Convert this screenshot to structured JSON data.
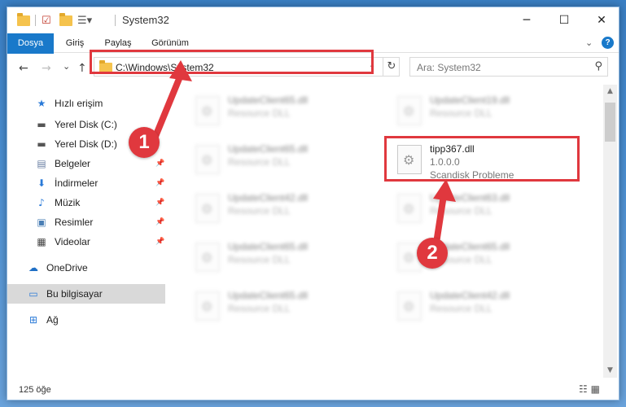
{
  "window": {
    "title": "System32",
    "controls": {
      "minimize": "─",
      "maximize": "☐",
      "close": "✕"
    }
  },
  "ribbon": {
    "tabs": [
      {
        "label": "Dosya",
        "active": true
      },
      {
        "label": "Giriş"
      },
      {
        "label": "Paylaş"
      },
      {
        "label": "Görünüm"
      }
    ],
    "help_label": "?"
  },
  "nav": {
    "back": "←",
    "forward": "→",
    "recent": "⌄",
    "up": "↑",
    "address": "C:\\Windows\\System32",
    "search_placeholder": "Ara: System32"
  },
  "sidebar": {
    "items": [
      {
        "label": "Hızlı erişim",
        "icon": "star-icon",
        "glyph": "★",
        "color": "#2a7ad8"
      },
      {
        "label": "Yerel Disk (C:)",
        "icon": "drive-icon",
        "glyph": "▬",
        "color": "#555555"
      },
      {
        "label": "Yerel Disk (D:)",
        "icon": "drive-icon",
        "glyph": "▬",
        "color": "#555555"
      },
      {
        "label": "Belgeler",
        "icon": "documents-icon",
        "glyph": "▤",
        "color": "#6a7fa3",
        "pinned": true
      },
      {
        "label": "İndirmeler",
        "icon": "download-icon",
        "glyph": "⬇",
        "color": "#2a7ad8",
        "pinned": true
      },
      {
        "label": "Müzik",
        "icon": "music-icon",
        "glyph": "♪",
        "color": "#2a7ad8",
        "pinned": true
      },
      {
        "label": "Resimler",
        "icon": "pictures-icon",
        "glyph": "▣",
        "color": "#4a7fb5",
        "pinned": true
      },
      {
        "label": "Videolar",
        "icon": "video-icon",
        "glyph": "▦",
        "color": "#444444",
        "pinned": true
      },
      {
        "label": "OneDrive",
        "icon": "cloud-icon",
        "glyph": "☁",
        "color": "#1f6fc5"
      },
      {
        "label": "Bu bilgisayar",
        "icon": "computer-icon",
        "glyph": "▭",
        "color": "#2a7ad8",
        "selected": true
      },
      {
        "label": "Ağ",
        "icon": "network-icon",
        "glyph": "⊞",
        "color": "#2a7ad8"
      }
    ]
  },
  "files": [
    {
      "name": "UpdateClient65.dll",
      "desc": "Resource DLL",
      "blurred": true
    },
    {
      "name": "UpdateClient19.dll",
      "desc": "Resource DLL",
      "blurred": true
    },
    {
      "name": "UpdateClient65.dll",
      "desc": "Resource DLL",
      "blurred": true
    },
    {
      "name": "tipp367.dll",
      "version": "1.0.0.0",
      "desc": "Scandisk Probleme",
      "blurred": false
    },
    {
      "name": "UpdateClient42.dll",
      "desc": "Resource DLL",
      "blurred": true
    },
    {
      "name": "UpdateClient63.dll",
      "desc": "Resource DLL",
      "blurred": true
    },
    {
      "name": "UpdateClient65.dll",
      "desc": "Resource DLL",
      "blurred": true
    },
    {
      "name": "UpdateClient65.dll",
      "desc": "Resource DLL",
      "blurred": true
    },
    {
      "name": "UpdateClient65.dll",
      "desc": "Resource DLL",
      "blurred": true
    },
    {
      "name": "UpdateClient42.dll",
      "desc": "Resource DLL",
      "blurred": true
    }
  ],
  "status": {
    "item_count": "125 öğe",
    "views_icons": "☷ ▦"
  },
  "callouts": [
    {
      "number": "1"
    },
    {
      "number": "2"
    }
  ],
  "colors": {
    "accent": "#1979ca",
    "callout": "#e0383e",
    "selected_row": "#d9d9d9"
  }
}
